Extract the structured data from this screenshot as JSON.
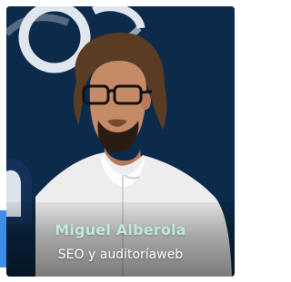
{
  "profile": {
    "name": "Miguel Alberola",
    "role": "SEO y auditoríaweb"
  },
  "colors": {
    "card_background": "#0c2a4a",
    "accent": "#3d8ee4",
    "name_text": "#bfe9de",
    "role_text": "#ffffff",
    "shirt": "#ededed"
  },
  "icons": {
    "background_logo": "circle-logo-icon"
  }
}
